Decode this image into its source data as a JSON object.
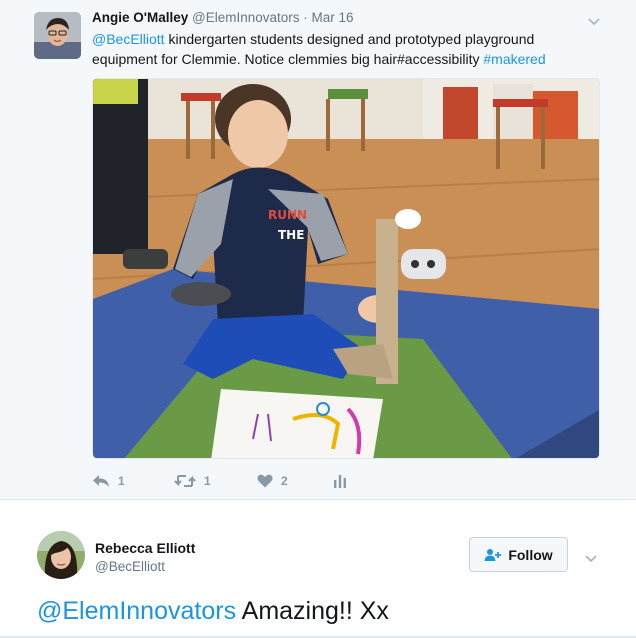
{
  "tweet": {
    "author_name": "Angie O'Malley",
    "author_handle": "@ElemInnovators",
    "separator": "·",
    "time": "Mar 16",
    "text_mention": "@BecElliott",
    "text_body": " kindergarten students designed and prototyped playground equipment for Clemmie. Notice clemmies big hair#accessibility ",
    "text_hashtag": "#makered",
    "photo_icon": "photo-kindergarten-student-with-prototype",
    "actions": {
      "reply_icon": "reply-icon",
      "reply_count": "1",
      "retweet_icon": "retweet-icon",
      "retweet_count": "1",
      "like_icon": "heart-icon",
      "like_count": "2",
      "analytics_icon": "analytics-icon"
    }
  },
  "reply": {
    "author_name": "Rebecca Elliott",
    "author_handle": "@BecElliott",
    "follow_label": "Follow",
    "follow_icon": "add-user-icon",
    "text_mention": "@ElemInnovators",
    "text_body": " Amazing!! Xx"
  },
  "colors": {
    "link": "#1b95e0",
    "card_background": "#f5f8fa",
    "muted_text": "#657786",
    "action_gray": "#8899a6"
  }
}
